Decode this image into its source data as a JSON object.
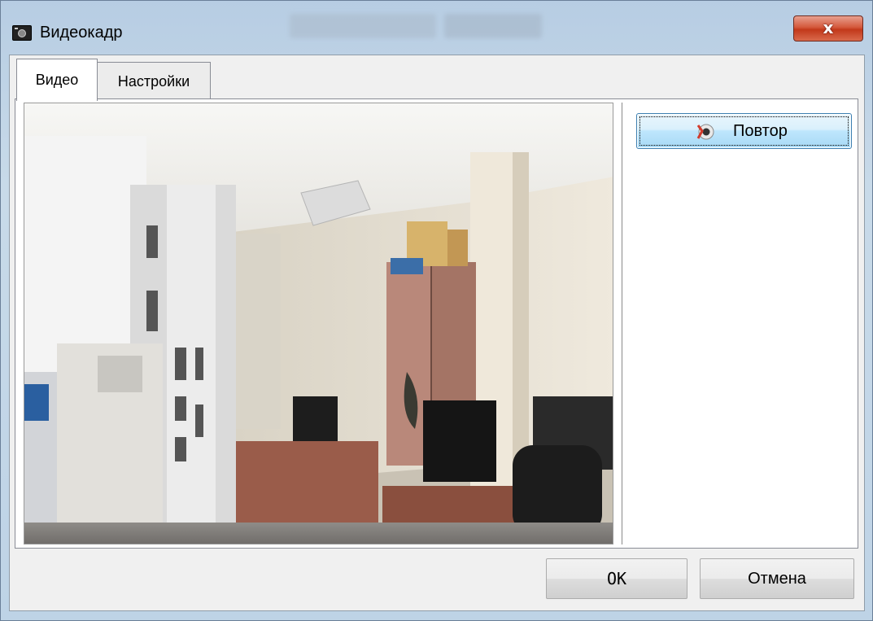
{
  "window": {
    "title": "Видеокадр",
    "close_label": "x"
  },
  "tabs": [
    {
      "label": "Видео",
      "active": true
    },
    {
      "label": "Настройки",
      "active": false
    }
  ],
  "video": {
    "retry_label": "Повтор"
  },
  "footer": {
    "ok_label": "OK",
    "cancel_label": "Отмена"
  },
  "colors": {
    "accent": "#3c7fb1",
    "close_red": "#c2381a"
  },
  "icons": {
    "app": "camera-icon",
    "retry": "retry-camera-icon"
  }
}
